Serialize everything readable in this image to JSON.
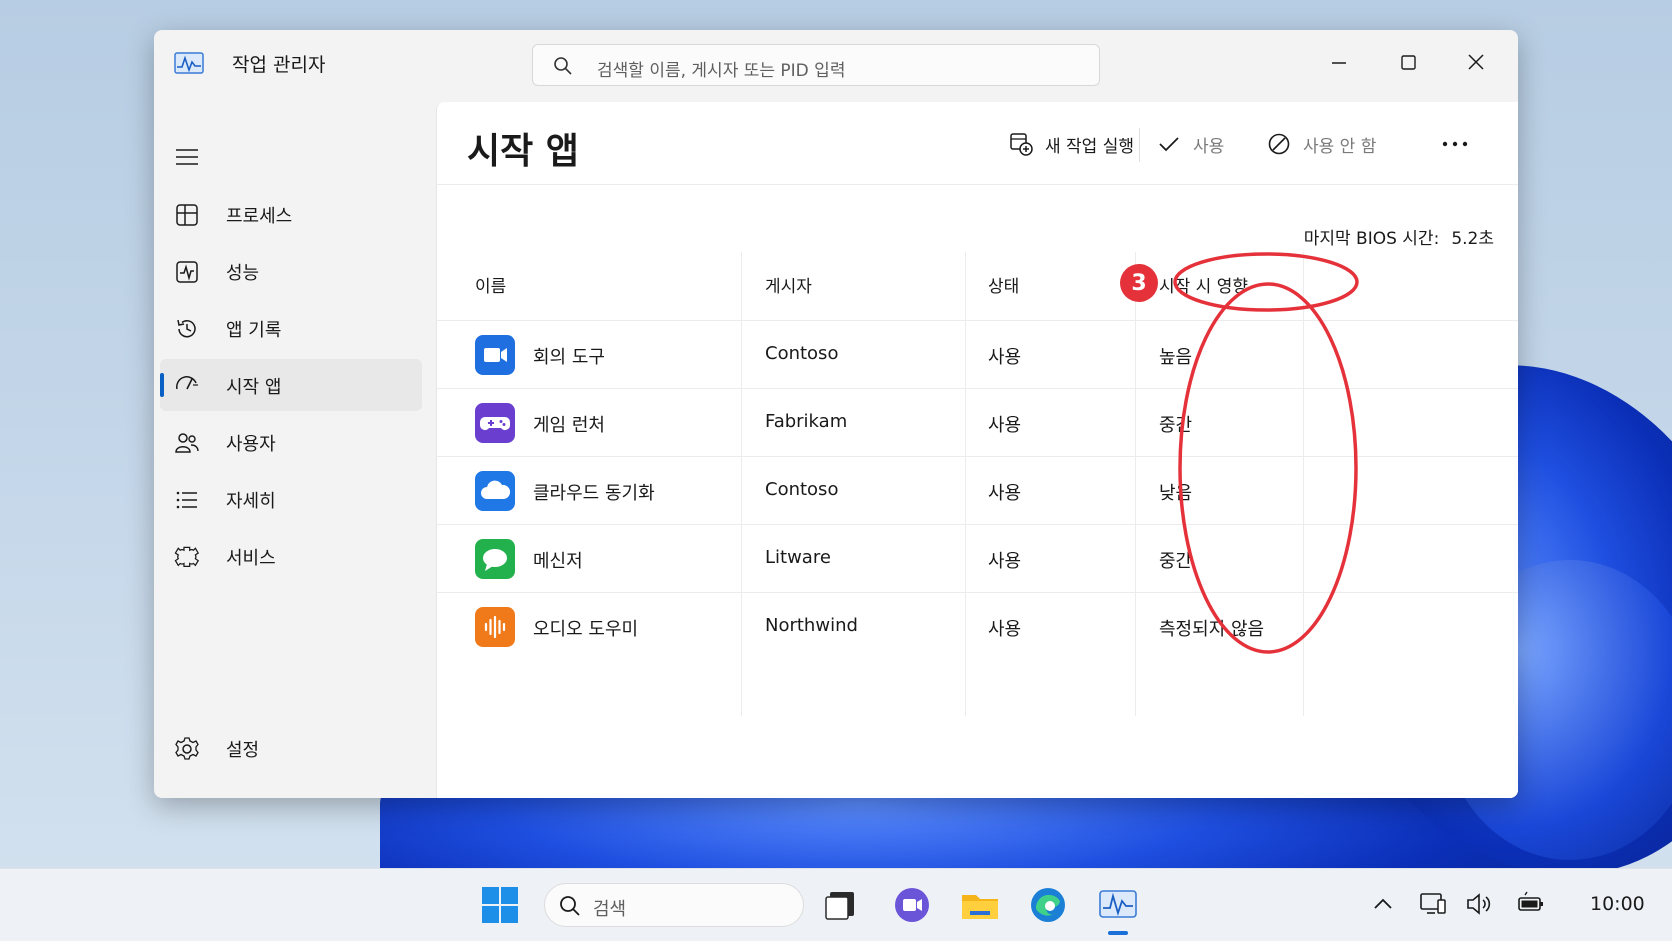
{
  "window": {
    "title": "작업 관리자",
    "search_placeholder": "검색할 이름, 게시자 또는 PID 입력"
  },
  "sidebar": {
    "items": [
      {
        "label": "프로세스",
        "icon": "processes-icon"
      },
      {
        "label": "성능",
        "icon": "performance-icon"
      },
      {
        "label": "앱 기록",
        "icon": "app-history-icon"
      },
      {
        "label": "시작 앱",
        "icon": "startup-apps-icon",
        "active": true
      },
      {
        "label": "사용자",
        "icon": "users-icon"
      },
      {
        "label": "자세히",
        "icon": "details-icon"
      },
      {
        "label": "서비스",
        "icon": "services-icon"
      }
    ],
    "settings_label": "설정"
  },
  "main": {
    "title": "시작 앱",
    "toolbar": {
      "new_task": "새 작업 실행",
      "enable": "사용",
      "disable": "사용 안 함"
    },
    "bios_label": "마지막 BIOS 시간:",
    "bios_value": "5.2초",
    "columns": {
      "name": "이름",
      "publisher": "게시자",
      "status": "상태",
      "impact": "시작 시 영향"
    },
    "rows": [
      {
        "name": "회의 도구",
        "publisher": "Contoso",
        "status": "사용",
        "impact": "높음",
        "icon": "video-camera-icon",
        "color": "#1f6fe0"
      },
      {
        "name": "게임 런처",
        "publisher": "Fabrikam",
        "status": "사용",
        "impact": "중간",
        "icon": "gamepad-icon",
        "color": "#6a3fd0"
      },
      {
        "name": "클라우드 동기화",
        "publisher": "Contoso",
        "status": "사용",
        "impact": "낮음",
        "icon": "cloud-icon",
        "color": "#1f78e6"
      },
      {
        "name": "메신저",
        "publisher": "Litware",
        "status": "사용",
        "impact": "중간",
        "icon": "chat-bubble-icon",
        "color": "#22b14c"
      },
      {
        "name": "오디오 도우미",
        "publisher": "Northwind",
        "status": "사용",
        "impact": "측정되지 않음",
        "icon": "audio-wave-icon",
        "color": "#f07a1a"
      }
    ]
  },
  "annotation": {
    "step_number": "3",
    "color": "#e5323a"
  },
  "taskbar": {
    "search_label": "검색",
    "clock": "10:00"
  }
}
